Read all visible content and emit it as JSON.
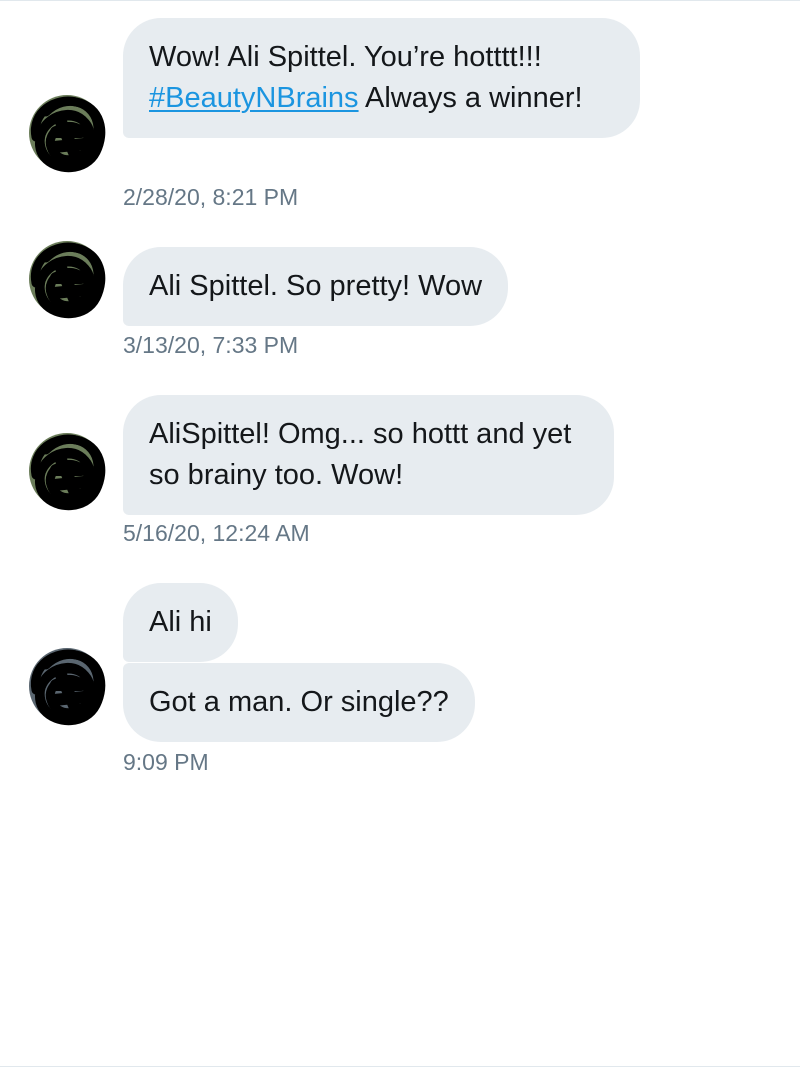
{
  "colors": {
    "bubble_bg": "#e7ecf0",
    "text": "#14171a",
    "timestamp": "#657786",
    "hashtag": "#1b95e0"
  },
  "messages": [
    {
      "text_before": "Wow! Ali Spittel. You’re hotttt!!!",
      "hashtag": "#BeautyNBrains",
      "text_after": " Always a winner!",
      "timestamp": "2/28/20, 8:21 PM"
    },
    {
      "text": "Ali Spittel. So pretty! Wow",
      "timestamp": "3/13/20, 7:33 PM"
    },
    {
      "text": "AliSpittel! Omg... so hottt and yet so brainy too. Wow!",
      "timestamp": "5/16/20, 12:24 AM"
    },
    {
      "texts": [
        "Ali hi",
        "Got a man. Or single??"
      ],
      "timestamp": "9:09 PM"
    }
  ],
  "icons": {
    "avatar": "scribbled-avatar-icon"
  }
}
